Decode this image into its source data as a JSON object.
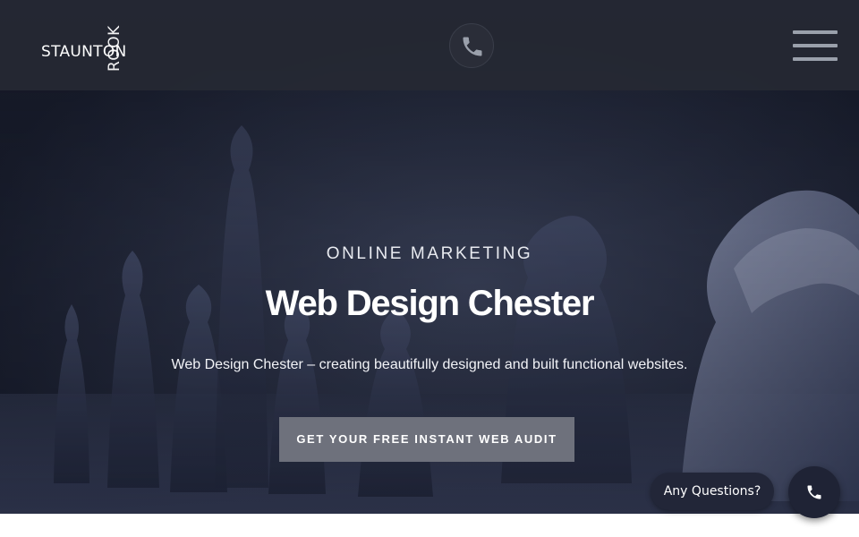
{
  "header": {
    "logo_main": "STAUNTON",
    "logo_vertical": "ROOK",
    "phone_icon": "phone-icon",
    "menu_icon": "hamburger-menu-icon"
  },
  "hero": {
    "eyebrow": "ONLINE MARKETING",
    "headline": "Web Design Chester",
    "subtext": "Web Design Chester – creating beautifully designed and built functional websites.",
    "cta_label": "GET YOUR FREE INSTANT WEB AUDIT",
    "background_image": "chess-pieces-image"
  },
  "chat_widget": {
    "label": "Any Questions?",
    "call_icon": "phone-icon"
  },
  "colors": {
    "header_bg": "#262934",
    "hero_bg": "#1a1e2e",
    "cta_bg": "#6e717c",
    "widget_bg": "#222638",
    "text": "#ffffff"
  }
}
